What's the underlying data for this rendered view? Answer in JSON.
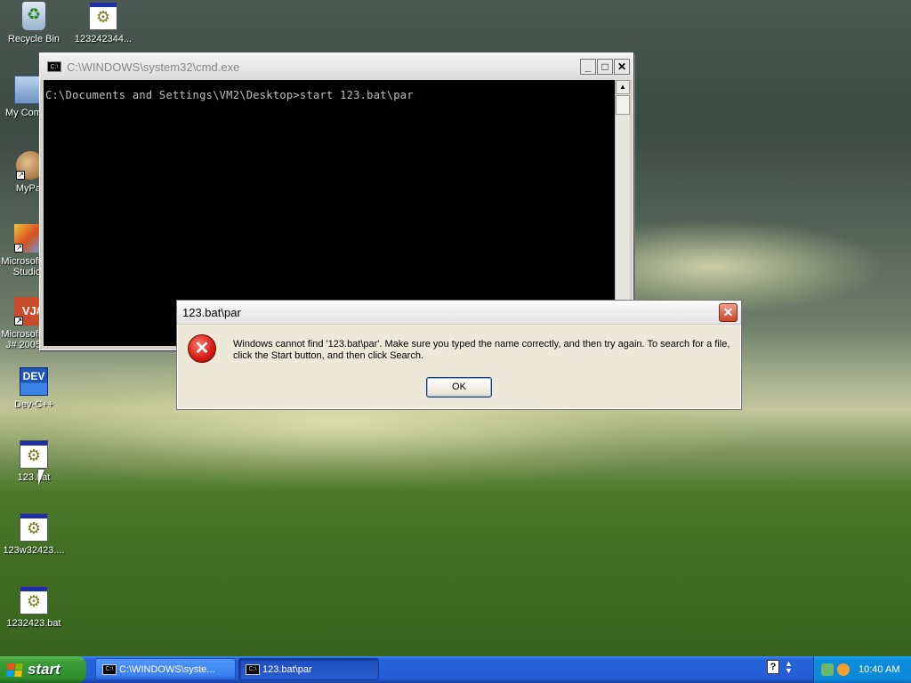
{
  "desktop": {
    "icons": [
      {
        "label": "Recycle Bin",
        "icon": "recycle-bin-icon"
      },
      {
        "label": "123242344...",
        "icon": "batch-file-icon"
      },
      {
        "label": "My Com",
        "icon": "my-computer-icon"
      },
      {
        "label": "MyPa",
        "icon": "people-shortcut-icon"
      },
      {
        "label": "Microsoft\nStudio",
        "icon": "visual-studio-icon"
      },
      {
        "label": "Microsoft\nJ# 2005",
        "icon": "visual-jsharp-icon"
      },
      {
        "label": "Dev-C++",
        "icon": "dev-cpp-icon"
      },
      {
        "label": "123.bat",
        "icon": "batch-file-icon"
      },
      {
        "label": "123w32423....",
        "icon": "batch-file-icon"
      },
      {
        "label": "1232423.bat",
        "icon": "batch-file-icon"
      }
    ],
    "icon_glyphs": {
      "vj": "VJ#",
      "dev": "DEV"
    }
  },
  "cmd_window": {
    "title": "C:\\WINDOWS\\system32\\cmd.exe",
    "prompt_line": "C:\\Documents and Settings\\VM2\\Desktop>start 123.bat\\par",
    "buttons": {
      "minimize": "_",
      "maximize": "□",
      "close": "✕"
    },
    "icon_text": "C:\\"
  },
  "error_dialog": {
    "title": "123.bat\\par",
    "message": "Windows cannot find '123.bat\\par'. Make sure you typed the name correctly, and then try again. To search for a file, click the Start button, and then click Search.",
    "ok_label": "OK",
    "close_glyph": "✕",
    "icon_glyph": "✕"
  },
  "taskbar": {
    "start_label": "start",
    "tasks": [
      {
        "label": "C:\\WINDOWS\\syste...",
        "active": false
      },
      {
        "label": "123.bat\\par",
        "active": true
      }
    ],
    "task_icon_text": "C:\\",
    "help_glyph": "?",
    "clock": "10:40 AM"
  },
  "colors": {
    "taskbar_blue": "#245dd6",
    "start_green": "#3c9e36",
    "tray_blue": "#0d88d9",
    "error_red": "#d11a10"
  }
}
